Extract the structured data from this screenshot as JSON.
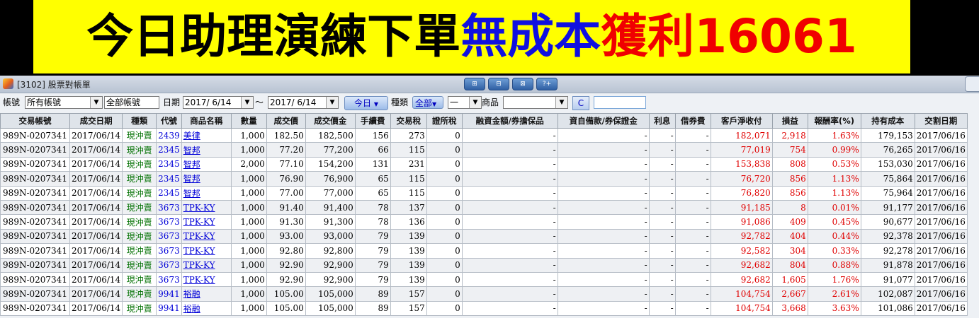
{
  "banner": {
    "part1": "今日助理演練下單",
    "part2": "無成本",
    "part3": "獲利16061"
  },
  "window": {
    "title": "[3102] 股票對帳單",
    "title_buttons": [
      "⊞",
      "⊟",
      "⊠",
      "?+"
    ]
  },
  "filters": {
    "account_label": "帳號",
    "account_value": "所有帳號",
    "all_accounts_text": "全部帳號",
    "date_label": "日期",
    "date_from": "2017/ 6/14",
    "tilde": "～",
    "date_to": "2017/ 6/14",
    "today_button": "今日",
    "category_label": "種類",
    "category_value": "全部",
    "sub_value": "一",
    "product_label": "商品",
    "product_value": "",
    "c_button": "C",
    "extra_field": ""
  },
  "table": {
    "columns": [
      "交易帳號",
      "成交日期",
      "種類",
      "代號",
      "商品名稱",
      "數量",
      "成交價",
      "成交價金",
      "手續費",
      "交易稅",
      "證所稅",
      "融資金額/券擔保品",
      "資自備款/券保證金",
      "利息",
      "借券費",
      "客戶淨收付",
      "損益",
      "報酬率(%)",
      "持有成本",
      "交割日期"
    ],
    "rows": [
      [
        "989N-0207341",
        "2017/06/14",
        "現沖賣",
        "2439",
        "美律",
        "1,000",
        "182.50",
        "182,500",
        "156",
        "273",
        "0",
        "-",
        "-",
        "-",
        "-",
        "182,071",
        "2,918",
        "1.63%",
        "179,153",
        "2017/06/16"
      ],
      [
        "989N-0207341",
        "2017/06/14",
        "現沖賣",
        "2345",
        "智邦",
        "1,000",
        "77.20",
        "77,200",
        "66",
        "115",
        "0",
        "-",
        "-",
        "-",
        "-",
        "77,019",
        "754",
        "0.99%",
        "76,265",
        "2017/06/16"
      ],
      [
        "989N-0207341",
        "2017/06/14",
        "現沖賣",
        "2345",
        "智邦",
        "2,000",
        "77.10",
        "154,200",
        "131",
        "231",
        "0",
        "-",
        "-",
        "-",
        "-",
        "153,838",
        "808",
        "0.53%",
        "153,030",
        "2017/06/16"
      ],
      [
        "989N-0207341",
        "2017/06/14",
        "現沖賣",
        "2345",
        "智邦",
        "1,000",
        "76.90",
        "76,900",
        "65",
        "115",
        "0",
        "-",
        "-",
        "-",
        "-",
        "76,720",
        "856",
        "1.13%",
        "75,864",
        "2017/06/16"
      ],
      [
        "989N-0207341",
        "2017/06/14",
        "現沖賣",
        "2345",
        "智邦",
        "1,000",
        "77.00",
        "77,000",
        "65",
        "115",
        "0",
        "-",
        "-",
        "-",
        "-",
        "76,820",
        "856",
        "1.13%",
        "75,964",
        "2017/06/16"
      ],
      [
        "989N-0207341",
        "2017/06/14",
        "現沖賣",
        "3673",
        "TPK-KY",
        "1,000",
        "91.40",
        "91,400",
        "78",
        "137",
        "0",
        "-",
        "-",
        "-",
        "-",
        "91,185",
        "8",
        "0.01%",
        "91,177",
        "2017/06/16"
      ],
      [
        "989N-0207341",
        "2017/06/14",
        "現沖賣",
        "3673",
        "TPK-KY",
        "1,000",
        "91.30",
        "91,300",
        "78",
        "136",
        "0",
        "-",
        "-",
        "-",
        "-",
        "91,086",
        "409",
        "0.45%",
        "90,677",
        "2017/06/16"
      ],
      [
        "989N-0207341",
        "2017/06/14",
        "現沖賣",
        "3673",
        "TPK-KY",
        "1,000",
        "93.00",
        "93,000",
        "79",
        "139",
        "0",
        "-",
        "-",
        "-",
        "-",
        "92,782",
        "404",
        "0.44%",
        "92,378",
        "2017/06/16"
      ],
      [
        "989N-0207341",
        "2017/06/14",
        "現沖賣",
        "3673",
        "TPK-KY",
        "1,000",
        "92.80",
        "92,800",
        "79",
        "139",
        "0",
        "-",
        "-",
        "-",
        "-",
        "92,582",
        "304",
        "0.33%",
        "92,278",
        "2017/06/16"
      ],
      [
        "989N-0207341",
        "2017/06/14",
        "現沖賣",
        "3673",
        "TPK-KY",
        "1,000",
        "92.90",
        "92,900",
        "79",
        "139",
        "0",
        "-",
        "-",
        "-",
        "-",
        "92,682",
        "804",
        "0.88%",
        "91,878",
        "2017/06/16"
      ],
      [
        "989N-0207341",
        "2017/06/14",
        "現沖賣",
        "3673",
        "TPK-KY",
        "1,000",
        "92.90",
        "92,900",
        "79",
        "139",
        "0",
        "-",
        "-",
        "-",
        "-",
        "92,682",
        "1,605",
        "1.76%",
        "91,077",
        "2017/06/16"
      ],
      [
        "989N-0207341",
        "2017/06/14",
        "現沖賣",
        "9941",
        "裕融",
        "1,000",
        "105.00",
        "105,000",
        "89",
        "157",
        "0",
        "-",
        "-",
        "-",
        "-",
        "104,754",
        "2,667",
        "2.61%",
        "102,087",
        "2017/06/16"
      ],
      [
        "989N-0207341",
        "2017/06/14",
        "現沖賣",
        "9941",
        "裕融",
        "1,000",
        "105.00",
        "105,000",
        "89",
        "157",
        "0",
        "-",
        "-",
        "-",
        "-",
        "104,754",
        "3,668",
        "3.63%",
        "101,086",
        "2017/06/16"
      ]
    ]
  },
  "colors": {
    "banner_bg": "#ffff00",
    "banner_blue": "#1010e0",
    "banner_red": "#f00000",
    "type_green": "#007000",
    "code_blue": "#0000d8",
    "profit_red": "#e00000"
  }
}
